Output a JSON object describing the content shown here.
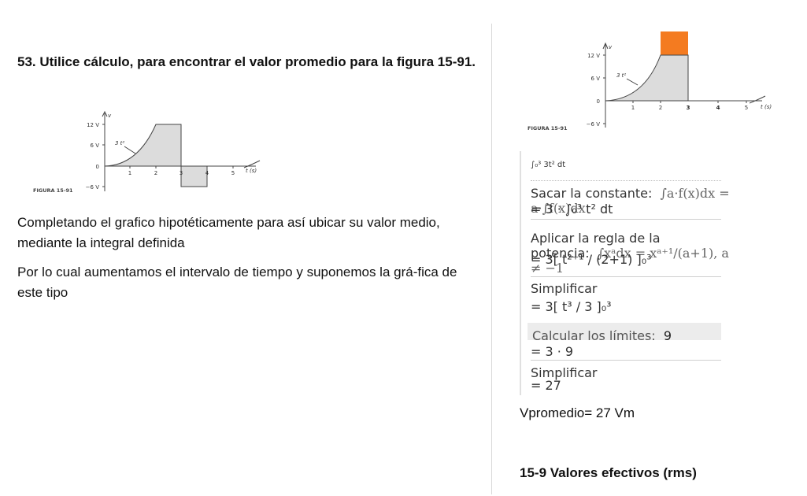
{
  "problem": {
    "title": "53. Utilice cálculo, para encontrar el valor promedio para la figura 15-91.",
    "paragraph1": "Completando el grafico hipotéticamente para así ubicar su valor medio, mediante la integral definida",
    "paragraph2": "Por lo cual aumentamos el intervalo de tiempo y suponemos la grá-fica de este tipo"
  },
  "figure_left": {
    "caption": "FIGURA 15-91",
    "y_axis_label": "v",
    "x_axis_label": "t (s)",
    "y_ticks": [
      "12 V",
      "6 V",
      "0",
      "−6 V"
    ],
    "x_ticks": [
      "1",
      "2",
      "3",
      "4",
      "5"
    ],
    "curve_label": "3 t²"
  },
  "figure_right": {
    "caption": "FIGURA 15-91",
    "y_axis_label": "v",
    "x_axis_label": "t (s)",
    "y_ticks": [
      "12 V",
      "6 V",
      "0",
      "−6 V"
    ],
    "x_ticks": [
      "1",
      "2",
      "3",
      "4",
      "5"
    ],
    "curve_label": "3 t²",
    "highlight_color": "#f47b20"
  },
  "solution": {
    "integral": "∫₀³ 3t² dt",
    "step1_label": "Sacar la constante:",
    "step1_rule": "∫a·f(x)dx = a·∫f(x)dx",
    "step1_expr": "= 3 · ∫₀³ t² dt",
    "step2_label": "Aplicar la regla de la potencia:",
    "step2_rule": "∫xᵃdx = xᵃ⁺¹/(a+1),   a ≠ −1",
    "step2_expr": "= 3[ t²⁺¹ / (2+1) ]₀³",
    "step3_label": "Simplificar",
    "step3_expr": "= 3[ t³ / 3 ]₀³",
    "step4_label": "Calcular los límites:",
    "step4_value": "9",
    "step4_expr": "= 3 · 9",
    "step5_label": "Simplificar",
    "step5_expr": "= 27"
  },
  "result": "Vpromedio= 27 Vm",
  "section_heading": "15-9 Valores efectivos (rms)"
}
